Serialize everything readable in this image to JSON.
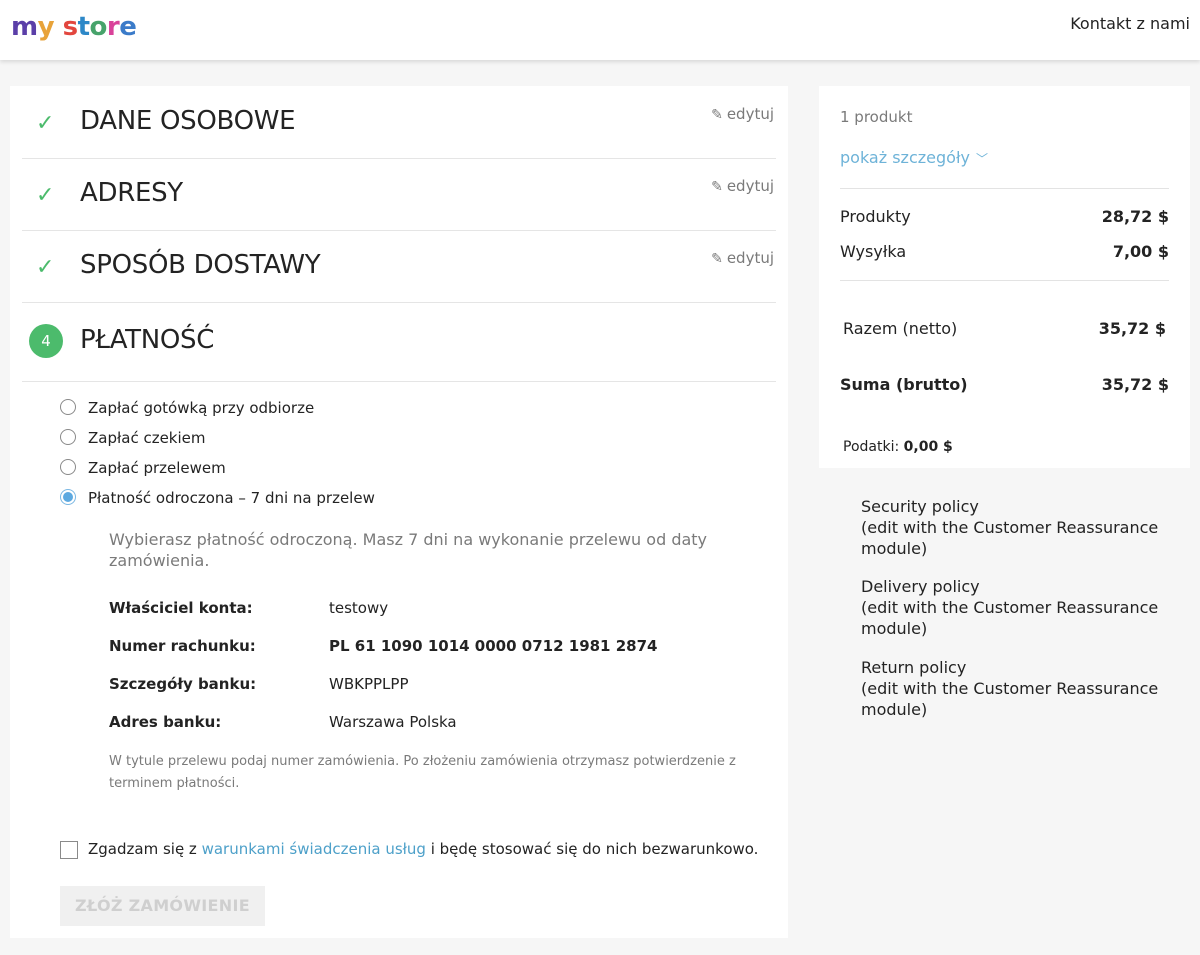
{
  "header": {
    "logo": [
      "m",
      "y",
      " ",
      "s",
      "t",
      "o",
      "r",
      "e"
    ],
    "contact": "Kontakt z nami"
  },
  "steps": [
    {
      "title": "DANE OSOBOWE",
      "edit": "edytuj",
      "icon": "check-icon"
    },
    {
      "title": "ADRESY",
      "edit": "edytuj",
      "icon": "check-icon"
    },
    {
      "title": "SPOSÓB DOSTAWY",
      "edit": "edytuj",
      "icon": "check-icon"
    },
    {
      "title": "PŁATNOŚĆ",
      "number": "4"
    }
  ],
  "payment": {
    "options": [
      {
        "label": "Zapłać gotówką przy odbiorze",
        "selected": false
      },
      {
        "label": "Zapłać czekiem",
        "selected": false
      },
      {
        "label": "Zapłać przelewem",
        "selected": false
      },
      {
        "label": "Płatność odroczona – 7 dni na przelew",
        "selected": true
      }
    ],
    "description": "Wybierasz płatność odroczoną. Masz 7 dni na wykonanie przelewu od daty zamówienia.",
    "details": [
      {
        "label": "Właściciel konta:",
        "value": "testowy"
      },
      {
        "label": "Numer rachunku:",
        "value": "PL 61 1090 1014 0000 0712 1981 2874"
      },
      {
        "label": "Szczegóły banku:",
        "value": "WBKPPLPP"
      },
      {
        "label": "Adres banku:",
        "value": "Warszawa Polska"
      }
    ],
    "note": "W tytule przelewu podaj numer zamówienia. Po złożeniu zamówienia otrzymasz potwierdzenie z terminem płatności.",
    "terms_before": "Zgadzam się z ",
    "terms_link": "warunkami świadczenia usług",
    "terms_after": " i będę stosować się do nich bezwarunkowo.",
    "order_button": "ZŁÓŻ ZAMÓWIENIE"
  },
  "summary": {
    "count": "1 produkt",
    "show_details": "pokaż szczegóły",
    "rows": [
      {
        "label": "Produkty",
        "value": "28,72 $"
      },
      {
        "label": "Wysyłka",
        "value": "7,00 $"
      }
    ],
    "net_label": "Razem (netto)",
    "net_value": "35,72 $",
    "gross_label": "Suma (brutto)",
    "gross_value": "35,72 $",
    "tax_label": "Podatki:",
    "tax_value": "0,00 $"
  },
  "reassurance": [
    {
      "title": "Security policy",
      "sub": "(edit with the Customer Reassurance module)"
    },
    {
      "title": "Delivery policy",
      "sub": "(edit with the Customer Reassurance module)"
    },
    {
      "title": "Return policy",
      "sub": "(edit with the Customer Reassurance module)"
    }
  ],
  "colors": {
    "accent_green": "#4cbb6c",
    "link_blue": "#4da0c9",
    "radio_blue": "#5da9e0"
  }
}
